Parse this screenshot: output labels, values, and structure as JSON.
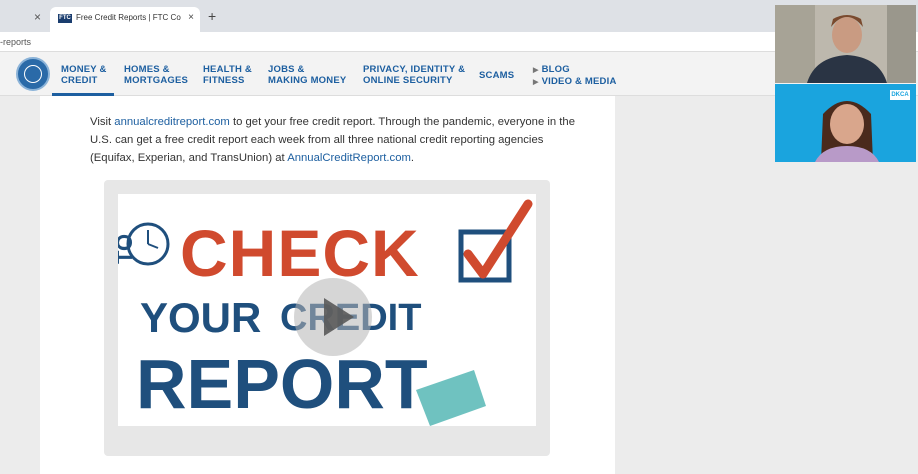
{
  "browser": {
    "prev_tab_close": "×",
    "active_tab": {
      "favicon": "FTC",
      "title": "Free Credit Reports | FTC Consu",
      "close": "×"
    },
    "new_tab": "+",
    "address_fragment": "-reports"
  },
  "nav": {
    "items": [
      {
        "line1": "MONEY &",
        "line2": "CREDIT"
      },
      {
        "line1": "HOMES &",
        "line2": "MORTGAGES"
      },
      {
        "line1": "HEALTH &",
        "line2": "FITNESS"
      },
      {
        "line1": "JOBS &",
        "line2": "MAKING MONEY"
      },
      {
        "line1": "PRIVACY, IDENTITY &",
        "line2": "ONLINE SECURITY"
      },
      {
        "line1": "SCAMS",
        "line2": ""
      },
      {
        "line1": "BLOG",
        "line2": "VIDEO & MEDIA"
      }
    ]
  },
  "article": {
    "text_before": "Visit ",
    "link1": "annualcreditreport.com",
    "text_middle": " to get your free credit report. Through the pandemic, everyone in the U.S. can get a free credit report each week from all three national credit reporting agencies (Equifax, Experian, and TransUnion) at ",
    "link2": "AnnualCreditReport.com",
    "text_end": "."
  },
  "video": {
    "word_to": "TO",
    "word_check": "CHECK",
    "word_your": "YOUR",
    "word_credit": "CREDIT",
    "word_report": "REPORT"
  },
  "webcams": {
    "cam2_logo": "DKCA"
  },
  "colors": {
    "brand_blue": "#1d5fa0",
    "check_red": "#d04a2e",
    "text_navy": "#1f4f7d"
  }
}
